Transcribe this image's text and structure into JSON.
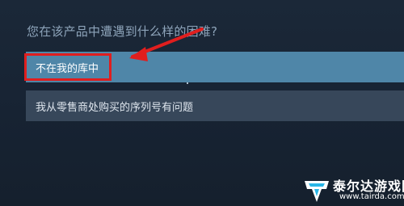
{
  "question": "您在该产品中遭遇到什么样的困难?",
  "options": [
    {
      "label": "不在我的库中",
      "state": "selected"
    },
    {
      "label": "我从零售商处购买的序列号有问题",
      "state": "normal"
    }
  ],
  "annotation": {
    "color": "#e01e1e"
  },
  "watermark": {
    "text": "泰尔达游戏网",
    "url": "www.tairda.com",
    "logo": "tairda-logo-icon"
  }
}
